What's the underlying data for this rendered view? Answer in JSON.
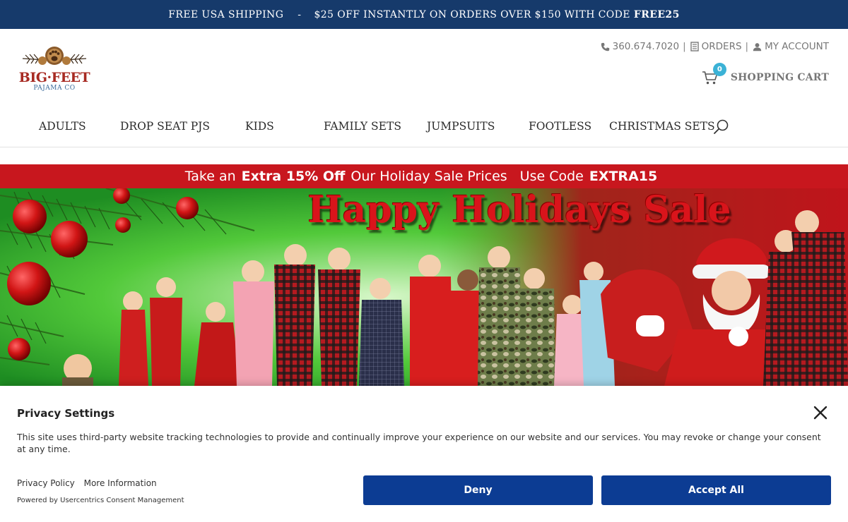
{
  "promo": {
    "shipping": "FREE USA SHIPPING",
    "separator": "-",
    "offer": "$25 OFF INSTANTLY ON ORDERS OVER $150 WITH CODE",
    "code": "FREE25"
  },
  "logo": {
    "line1": "BIG·FEET",
    "line2": "PAJAMA CO"
  },
  "utility": {
    "phone": "360.674.7020",
    "orders": "ORDERS",
    "account": "MY ACCOUNT",
    "divider": "|"
  },
  "cart": {
    "count": "0",
    "label": "SHOPPING CART"
  },
  "nav": {
    "items": [
      "ADULTS",
      "DROP SEAT PJS",
      "KIDS",
      "FAMILY SETS",
      "JUMPSUITS",
      "FOOTLESS",
      "CHRISTMAS SETS"
    ]
  },
  "sale_banner": {
    "lead": "Take an",
    "bold1": "Extra 15% Off",
    "middle": "Our Holiday Sale Prices",
    "use_code": "Use Code",
    "code": "EXTRA15"
  },
  "hero": {
    "title": "Happy Holidays Sale"
  },
  "privacy": {
    "title": "Privacy Settings",
    "text": "This site uses third-party website tracking technologies to provide and continually improve your experience on our website and our services. You may revoke or change your consent at any time.",
    "privacy_policy": "Privacy Policy",
    "more_info": "More Information",
    "powered_by": "Powered by Usercentrics Consent Management",
    "deny": "Deny",
    "accept_all": "Accept All"
  },
  "colors": {
    "promo_bg": "#163a6b",
    "sale_red": "#c8171e",
    "button_blue": "#0c3c93",
    "badge_blue": "#3bb2d6"
  }
}
